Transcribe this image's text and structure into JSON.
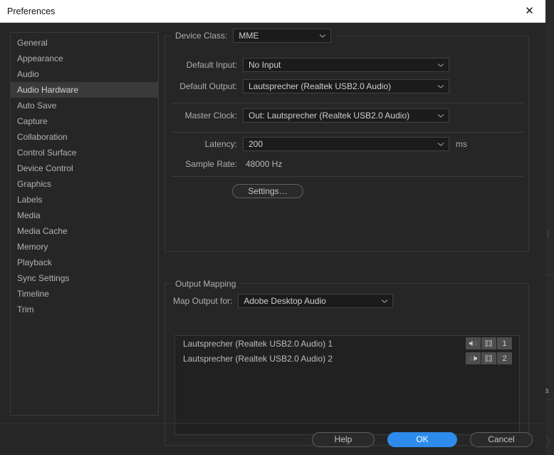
{
  "window": {
    "title": "Preferences",
    "close_label": "✕"
  },
  "sidebar": {
    "items": [
      {
        "label": "General",
        "selected": false
      },
      {
        "label": "Appearance",
        "selected": false
      },
      {
        "label": "Audio",
        "selected": false
      },
      {
        "label": "Audio Hardware",
        "selected": true
      },
      {
        "label": "Auto Save",
        "selected": false
      },
      {
        "label": "Capture",
        "selected": false
      },
      {
        "label": "Collaboration",
        "selected": false
      },
      {
        "label": "Control Surface",
        "selected": false
      },
      {
        "label": "Device Control",
        "selected": false
      },
      {
        "label": "Graphics",
        "selected": false
      },
      {
        "label": "Labels",
        "selected": false
      },
      {
        "label": "Media",
        "selected": false
      },
      {
        "label": "Media Cache",
        "selected": false
      },
      {
        "label": "Memory",
        "selected": false
      },
      {
        "label": "Playback",
        "selected": false
      },
      {
        "label": "Sync Settings",
        "selected": false
      },
      {
        "label": "Timeline",
        "selected": false
      },
      {
        "label": "Trim",
        "selected": false
      }
    ]
  },
  "device_group": {
    "device_class_label": "Device Class:",
    "device_class_value": "MME",
    "default_input_label": "Default Input:",
    "default_input_value": "No Input",
    "default_output_label": "Default Output:",
    "default_output_value": "Lautsprecher (Realtek USB2.0 Audio)",
    "master_clock_label": "Master Clock:",
    "master_clock_value": "Out: Lautsprecher (Realtek USB2.0 Audio)",
    "latency_label": "Latency:",
    "latency_value": "200",
    "latency_unit": "ms",
    "sample_rate_label": "Sample Rate:",
    "sample_rate_value": "48000 Hz",
    "settings_button": "Settings…"
  },
  "output_mapping": {
    "group_title": "Output Mapping",
    "map_output_label": "Map Output for:",
    "map_output_value": "Adobe Desktop Audio",
    "rows": [
      {
        "name": "Lautsprecher (Realtek USB2.0 Audio) 1",
        "channel": "1"
      },
      {
        "name": "Lautsprecher (Realtek USB2.0 Audio) 2",
        "channel": "2"
      }
    ]
  },
  "footer": {
    "help": "Help",
    "ok": "OK",
    "cancel": "Cancel"
  },
  "background": {
    "edge_text": "ia"
  },
  "colors": {
    "accent": "#2d8ceb",
    "dialog_bg": "#262626",
    "field_bg": "#1b1b1b",
    "selected_row": "#3a3a3a"
  }
}
